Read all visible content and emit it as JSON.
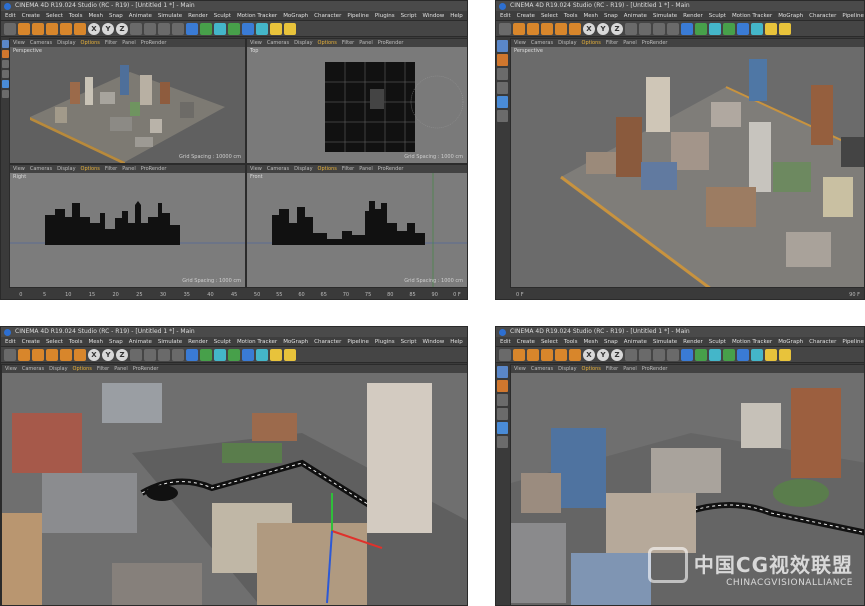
{
  "app": {
    "title": "CINEMA 4D R19.024 Studio (RC - R19) - [Untitled 1 *] - Main"
  },
  "menu": [
    "Edit",
    "Create",
    "Select",
    "Tools",
    "Mesh",
    "Snap",
    "Animate",
    "Simulate",
    "Render",
    "Sculpt",
    "Motion Tracker",
    "MoGraph",
    "Character",
    "Pipeline",
    "Plugins",
    "Script",
    "Window",
    "Help"
  ],
  "toolbar": {
    "x_axis": "X",
    "y_axis": "Y",
    "z_axis": "Z"
  },
  "viewport_menu": [
    "View",
    "Cameras",
    "Display",
    "Options",
    "Filter",
    "Panel",
    "ProRender"
  ],
  "viewports": {
    "perspective": "Perspective",
    "top": "Top",
    "right": "Right",
    "front": "Front",
    "grid_spacing_1": "Grid Spacing : 10000 cm",
    "grid_spacing_2": "Grid Spacing : 1000 cm",
    "grid_spacing_3": "Grid Spacing : 1000 cm",
    "grid_spacing_4": "Grid Spacing : 1000 cm"
  },
  "timeline_ticks_left": [
    "0",
    "5",
    "10",
    "15",
    "20",
    "25",
    "30",
    "35",
    "40",
    "45"
  ],
  "timeline_ticks_right": [
    "50",
    "55",
    "60",
    "65",
    "70",
    "75",
    "80",
    "85",
    "90",
    "0 F"
  ],
  "timeline_2": {
    "start": "0 F",
    "end": "90 F"
  },
  "watermark": {
    "cn": "中国CG视效联盟",
    "en": "CHINACGVISIONALLIANCE"
  },
  "colors": {
    "accent_orange": "#e8b23a",
    "viewport_bg": "#5a5a5a",
    "ui_dark": "#3b3b3b"
  }
}
